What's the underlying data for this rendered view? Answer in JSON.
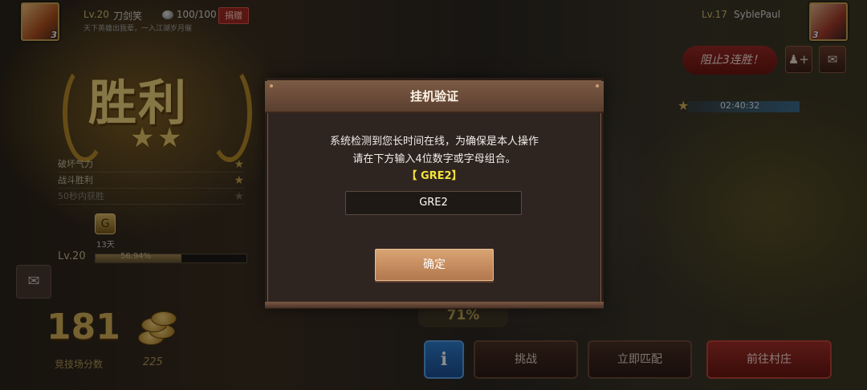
{
  "player_left": {
    "level": "Lv.20",
    "name": "刀剑笑",
    "rank": "3",
    "coins": "100/100",
    "donate_label": "捐赠",
    "motto": "天下英雄出我辈，一入江湖岁月催"
  },
  "player_right": {
    "level": "Lv.17",
    "name": "SyblePaul",
    "rank": "3"
  },
  "streak_button": "阻止3连胜！",
  "icons": {
    "add_friend": "add-friend-icon",
    "mail": "mail-icon",
    "chat": "chat-icon"
  },
  "timer": "02:40:32",
  "victory": {
    "title": "胜利",
    "stars": 2
  },
  "conditions": [
    {
      "label": "破坏气力",
      "done": true
    },
    {
      "label": "战斗胜利",
      "done": true
    },
    {
      "label": "50秒内获胜",
      "done": false
    }
  ],
  "reward": {
    "days": "13天"
  },
  "exp": {
    "level": "Lv.20",
    "percent_label": "56.94%",
    "fraction": 0.5694
  },
  "arena": {
    "score": "181",
    "score_label": "竞技场分数",
    "gold": "225"
  },
  "progress_center": "71%",
  "buttons": {
    "info": "i",
    "challenge": "挑战",
    "match": "立即匹配",
    "village": "前往村庄"
  },
  "modal": {
    "title": "挂机验证",
    "line1": "系统检测到您长时间在线，为确保是本人操作",
    "line2": "请在下方输入4位数字或字母组合。",
    "code": "【 GRE2】",
    "input_value": "GRE2",
    "confirm": "确定"
  },
  "colors": {
    "accent_gold": "#d8b35a",
    "confirm": "#c58c5f",
    "danger": "#a5302a",
    "info": "#2f7fd0",
    "code": "#f3e23c"
  }
}
